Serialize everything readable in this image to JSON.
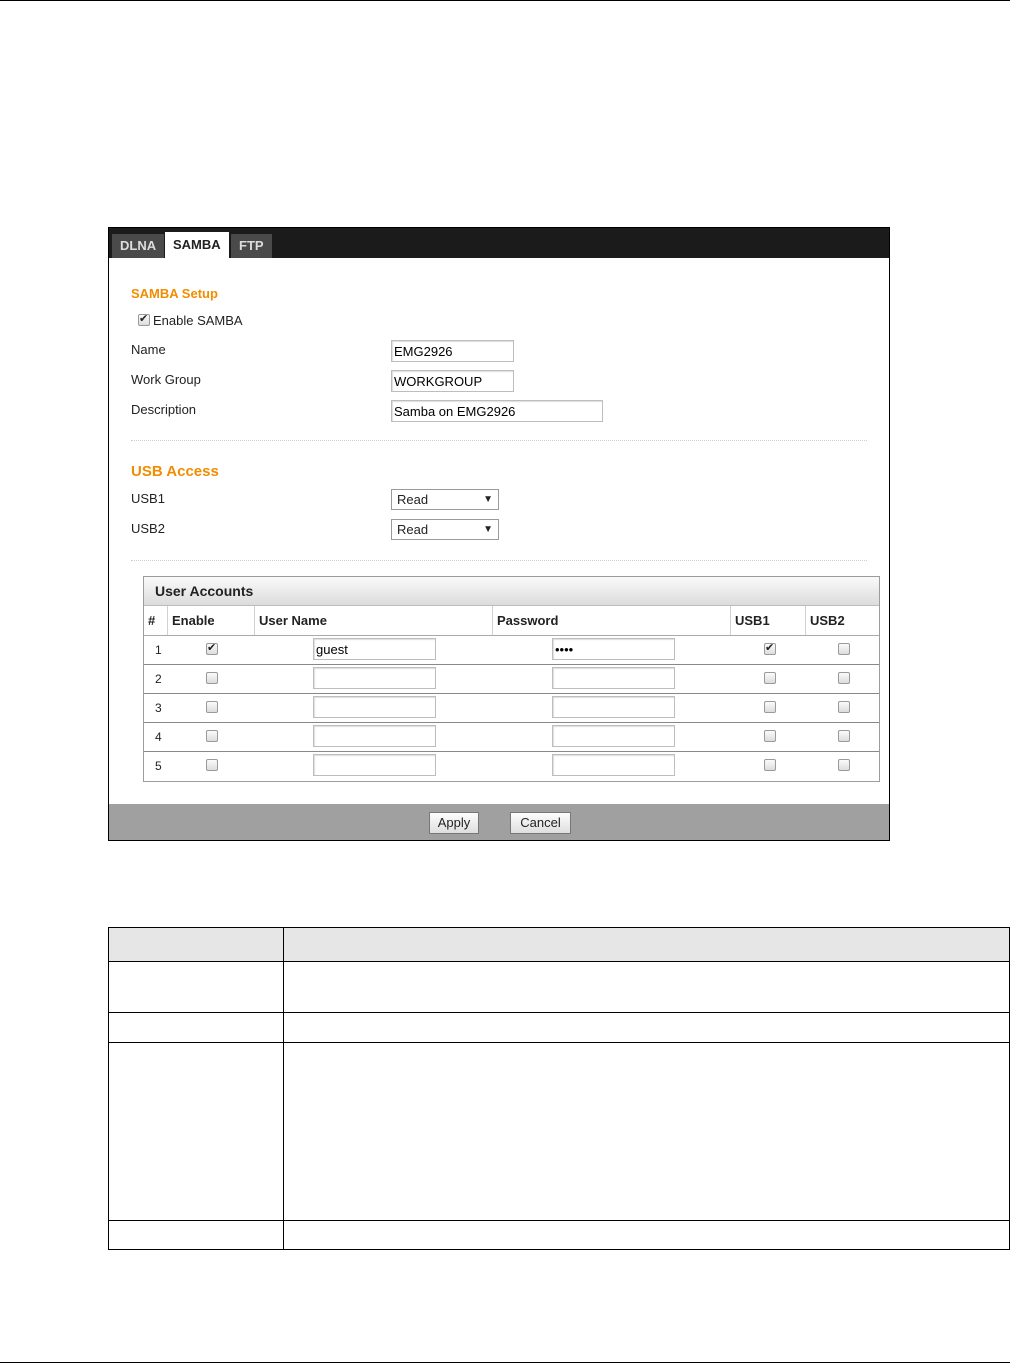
{
  "tabs": [
    {
      "label": "DLNA",
      "active": false
    },
    {
      "label": "SAMBA",
      "active": true
    },
    {
      "label": "FTP",
      "active": false
    }
  ],
  "samba_setup": {
    "title": "SAMBA Setup",
    "enable_label": "Enable SAMBA",
    "enable_checked": true,
    "name_label": "Name",
    "name_value": "EMG2926",
    "workgroup_label": "Work Group",
    "workgroup_value": "WORKGROUP",
    "description_label": "Description",
    "description_value": "Samba on EMG2926"
  },
  "usb_access": {
    "title": "USB Access",
    "usb1_label": "USB1",
    "usb1_value": "Read",
    "usb2_label": "USB2",
    "usb2_value": "Read",
    "arrow_icon": "triangle-down"
  },
  "user_accounts": {
    "title": "User Accounts",
    "columns": [
      "#",
      "Enable",
      "User Name",
      "Password",
      "USB1",
      "USB2"
    ],
    "rows": [
      {
        "num": "1",
        "enable": true,
        "username": "guest",
        "password": "••••",
        "usb1": true,
        "usb2": false
      },
      {
        "num": "2",
        "enable": false,
        "username": "",
        "password": "",
        "usb1": false,
        "usb2": false
      },
      {
        "num": "3",
        "enable": false,
        "username": "",
        "password": "",
        "usb1": false,
        "usb2": false
      },
      {
        "num": "4",
        "enable": false,
        "username": "",
        "password": "",
        "usb1": false,
        "usb2": false
      },
      {
        "num": "5",
        "enable": false,
        "username": "",
        "password": "",
        "usb1": false,
        "usb2": false
      }
    ]
  },
  "buttons": {
    "apply": "Apply",
    "cancel": "Cancel"
  },
  "colors": {
    "section_title": "#f28c00",
    "tab_bar": "#1b1b1b",
    "footer_bar": "#a0a0a0"
  }
}
